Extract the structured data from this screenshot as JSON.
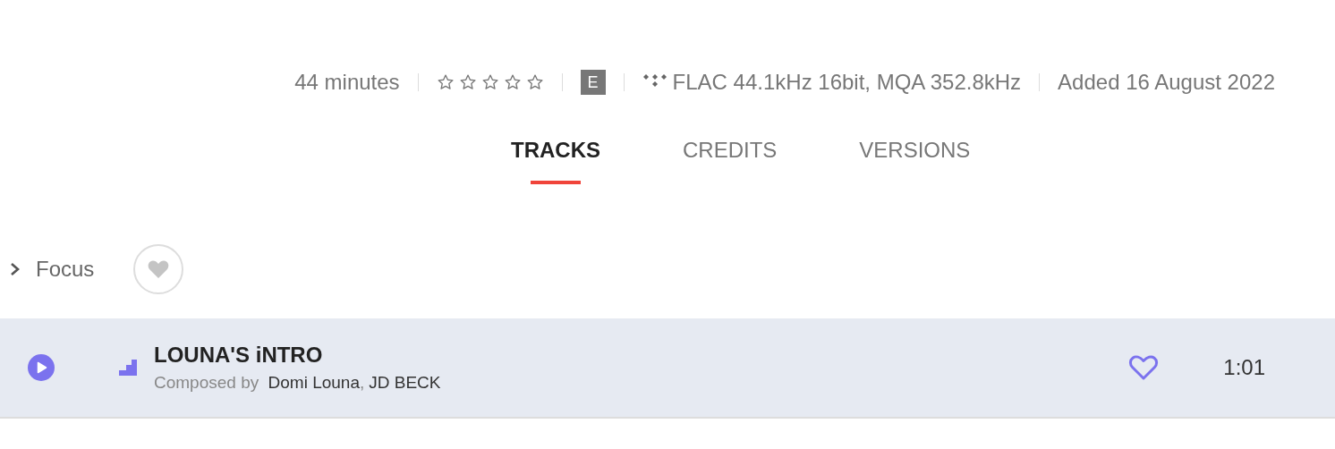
{
  "album_meta": {
    "duration": "44 minutes",
    "stars": 0,
    "explicit_badge": "E",
    "quality": "FLAC 44.1kHz 16bit, MQA 352.8kHz",
    "added": "Added 16 August 2022"
  },
  "tabs": [
    {
      "label": "TRACKS",
      "selected": true
    },
    {
      "label": "CREDITS",
      "selected": false
    },
    {
      "label": "VERSIONS",
      "selected": false
    }
  ],
  "section": {
    "title": "Focus",
    "expanded": false,
    "favorited": false
  },
  "tracks": [
    {
      "title": "LOUNA'S iNTRO",
      "credit_label": "Composed by",
      "composers": [
        "Domi Louna",
        "JD BECK"
      ],
      "composer_separator": ",",
      "duration": "1:01",
      "selected": true,
      "favorited": false
    }
  ]
}
